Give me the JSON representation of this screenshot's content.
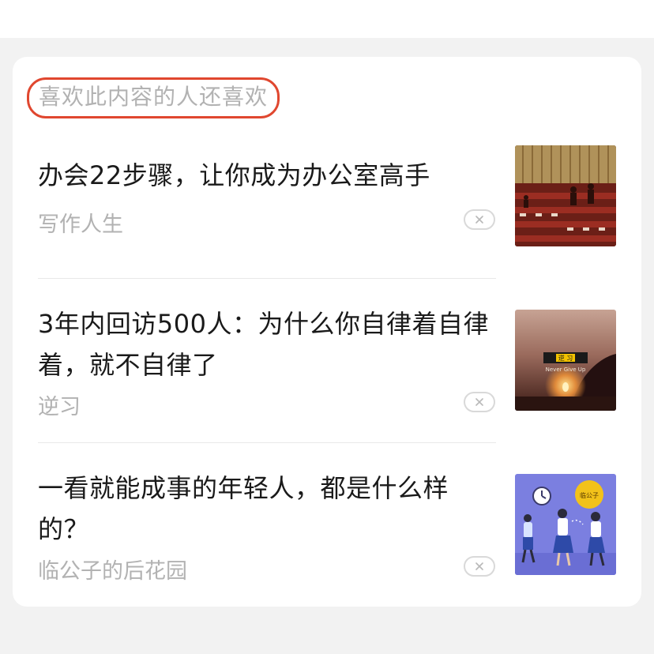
{
  "section": {
    "title": "喜欢此内容的人还喜欢"
  },
  "items": [
    {
      "title": "办会22步骤，让你成为办公室高手",
      "source": "写作人生",
      "thumb_icon": "conference-hall-photo-icon"
    },
    {
      "title": "3年内回访500人：为什么你自律着自律着，就不自律了",
      "source": "逆习",
      "thumb_icon": "sunset-candle-photo-icon",
      "thumb_text": {
        "badge": "逆 习",
        "caption": "Never Give Up"
      }
    },
    {
      "title": "一看就能成事的年轻人，都是什么样的？",
      "source": "临公子的后花园",
      "thumb_icon": "walking-people-illustration-icon",
      "thumb_text": {
        "badge": "临公子"
      }
    }
  ],
  "colors": {
    "highlight_border": "#e0472f",
    "muted_text": "#b2b2b2",
    "title_text": "#1a1a1a"
  }
}
